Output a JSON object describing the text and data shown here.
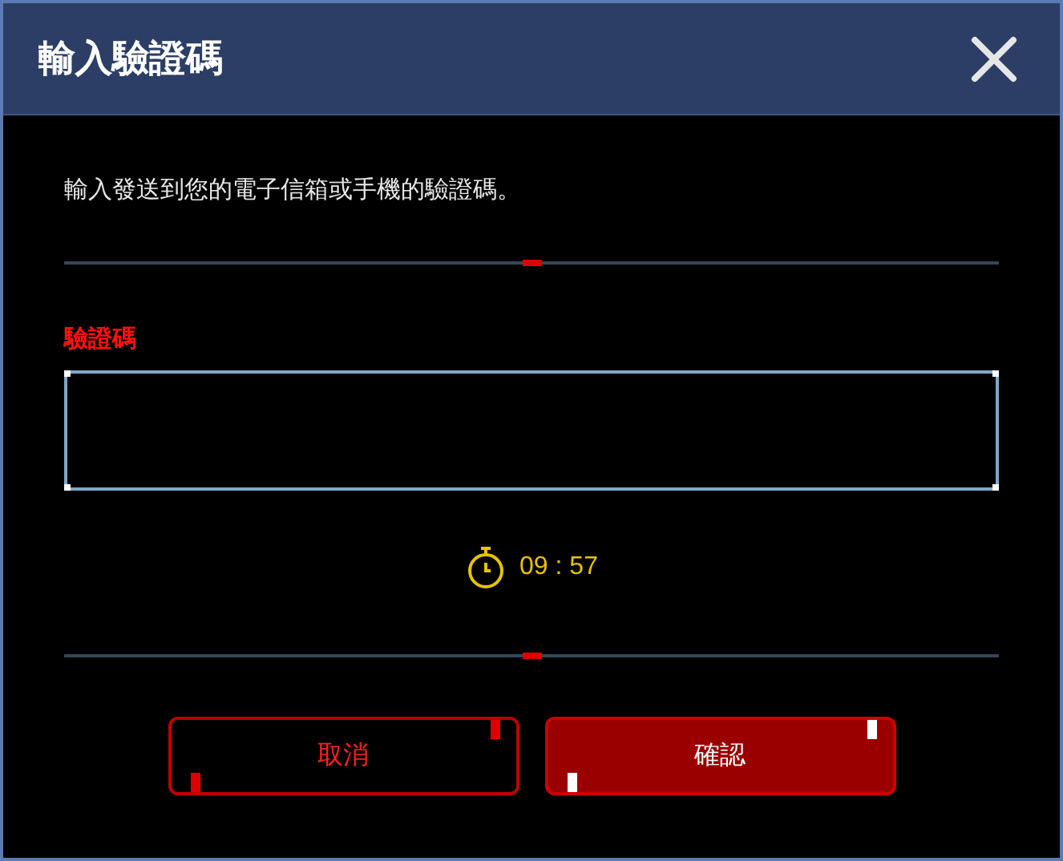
{
  "dialog": {
    "title": "輸入驗證碼",
    "message": "輸入發送到您的電子信箱或手機的驗證碼。",
    "field": {
      "label": "驗證碼"
    },
    "timer": "09 : 57",
    "buttons": [
      {
        "label": "取消",
        "kind": "secondary"
      },
      {
        "label": "確認",
        "kind": "primary"
      }
    ]
  }
}
